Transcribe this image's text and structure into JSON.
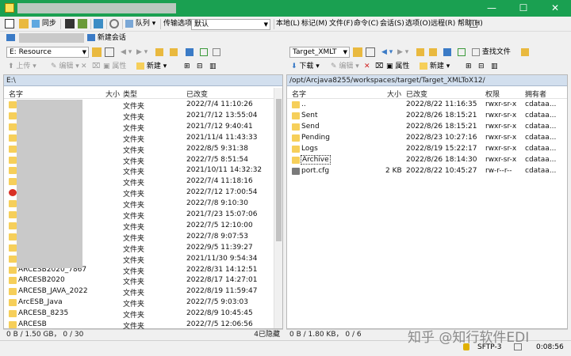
{
  "window": {
    "minimize": "—",
    "maximize": "☐",
    "close": "✕"
  },
  "toolbar1": {
    "sync": "同步",
    "queue": "队列",
    "transfer_label": "传输选项",
    "transfer_value": "默认"
  },
  "menu": [
    "本地(L)",
    "标记(M)",
    "文件(F)",
    "命令(C)",
    "会话(S)",
    "选项(O)",
    "远程(R)",
    "帮助(H)"
  ],
  "session": {
    "new": "新建会话"
  },
  "left": {
    "drive": "E: Resource",
    "upload": "上传",
    "edit": "编辑",
    "props": "属性",
    "new": "新建",
    "path": "E:\\",
    "cols": {
      "name": "名字",
      "size": "大小",
      "type": "类型",
      "changed": "已改变"
    },
    "rows": [
      {
        "name": "",
        "type": "文件夹",
        "changed": "2022/7/4  11:10:26"
      },
      {
        "name": "",
        "type": "文件夹",
        "changed": "2021/7/12  13:55:04"
      },
      {
        "name": "",
        "type": "文件夹",
        "changed": "2021/7/12  9:40:41"
      },
      {
        "name": "",
        "type": "文件夹",
        "changed": "2021/11/4  11:43:33"
      },
      {
        "name": "",
        "type": "文件夹",
        "changed": "2022/8/5  9:31:38"
      },
      {
        "name": "",
        "type": "文件夹",
        "changed": "2022/7/5  8:51:54"
      },
      {
        "name": "",
        "type": "文件夹",
        "changed": "2021/10/11  14:32:32"
      },
      {
        "name": "",
        "type": "文件夹",
        "changed": "2022/7/4  11:18:16"
      },
      {
        "name": "",
        "type": "文件夹",
        "changed": "2022/7/12  17:00:54"
      },
      {
        "name": "",
        "type": "文件夹",
        "changed": "2022/7/8  9:10:30"
      },
      {
        "name": "",
        "type": "文件夹",
        "changed": "2021/7/23  15:07:06"
      },
      {
        "name": "",
        "type": "文件夹",
        "changed": "2022/7/5  12:10:00"
      },
      {
        "name": "",
        "type": "文件夹",
        "changed": "2022/7/8  9:07:53"
      },
      {
        "name": "",
        "type": "文件夹",
        "changed": "2022/9/5  11:39:27"
      },
      {
        "name": "",
        "type": "文件夹",
        "changed": "2021/11/30  9:54:34"
      },
      {
        "name": "ARCESB2020_7867",
        "type": "文件夹",
        "changed": "2022/8/31  14:12:51"
      },
      {
        "name": "ARCESB2020",
        "type": "文件夹",
        "changed": "2022/8/17  14:27:01"
      },
      {
        "name": "ARCESB_JAVA_2022",
        "type": "文件夹",
        "changed": "2022/8/19  11:59:47"
      },
      {
        "name": "ArcESB_Java",
        "type": "文件夹",
        "changed": "2022/7/5  9:03:03"
      },
      {
        "name": "ARCESB_8235",
        "type": "文件夹",
        "changed": "2022/8/9  10:45:45"
      },
      {
        "name": "ARCESB",
        "type": "文件夹",
        "changed": "2022/7/5  12:06:56"
      }
    ],
    "status_left": "0 B / 1.50 GB， 0 / 30",
    "status_right": "4已隐藏"
  },
  "right": {
    "dir": "Target_XMLT",
    "download": "下载",
    "edit": "编辑",
    "props": "属性",
    "new": "新建",
    "find": "查找文件",
    "path": "/opt/Arcjava8255/workspaces/target/Target_XMLToX12/",
    "cols": {
      "name": "名字",
      "size": "大小",
      "changed": "已改变",
      "rights": "权限",
      "owner": "拥有者"
    },
    "rows": [
      {
        "icon": "up",
        "name": "..",
        "size": "",
        "changed": "2022/8/22 11:16:35",
        "rights": "rwxr-sr-x",
        "owner": "cdataa..."
      },
      {
        "icon": "folder",
        "name": "Sent",
        "size": "",
        "changed": "2022/8/26 18:15:21",
        "rights": "rwxr-sr-x",
        "owner": "cdataa..."
      },
      {
        "icon": "folder",
        "name": "Send",
        "size": "",
        "changed": "2022/8/26 18:15:21",
        "rights": "rwxr-sr-x",
        "owner": "cdataa..."
      },
      {
        "icon": "folder",
        "name": "Pending",
        "size": "",
        "changed": "2022/8/23 10:27:16",
        "rights": "rwxr-sr-x",
        "owner": "cdataa..."
      },
      {
        "icon": "folder",
        "name": "Logs",
        "size": "",
        "changed": "2022/8/19 15:22:17",
        "rights": "rwxr-sr-x",
        "owner": "cdataa..."
      },
      {
        "icon": "folder",
        "name": "Archive",
        "size": "",
        "changed": "2022/8/26 18:14:30",
        "rights": "rwxr-sr-x",
        "owner": "cdataa..."
      },
      {
        "icon": "file",
        "name": "port.cfg",
        "size": "2 KB",
        "changed": "2022/8/22 10:45:27",
        "rights": "rw-r--r--",
        "owner": "cdataa..."
      }
    ],
    "status": "0 B / 1.80 KB， 0 / 6"
  },
  "bottom": {
    "protocol": "SFTP-3",
    "time": "0:08:56"
  },
  "watermark": "知乎 @知行软件EDI"
}
